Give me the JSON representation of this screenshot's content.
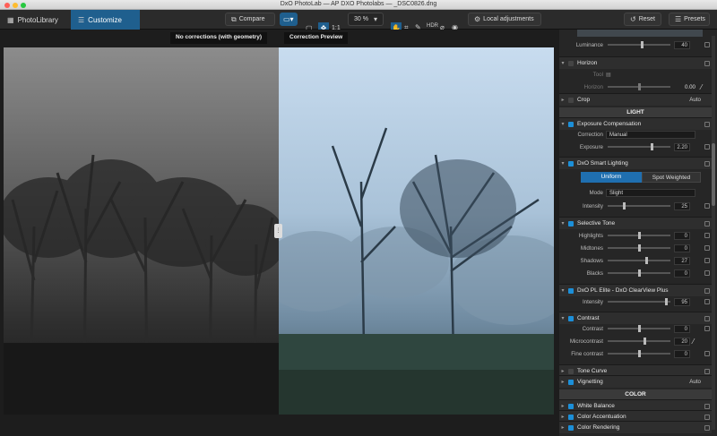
{
  "window": {
    "title": "DxO PhotoLab — AP DXO Photolabs — _DSC0826.dng"
  },
  "toolbar": {
    "tab_library": "PhotoLibrary",
    "tab_customize": "Customize",
    "compare_label": "Compare",
    "zoom_ratio": "1:1",
    "zoom_value": "30 %",
    "local_adjustments": "Local adjustments",
    "reset_label": "Reset",
    "presets_label": "Presets"
  },
  "viewer": {
    "left_title": "No corrections (with geometry)",
    "right_title": "Correction Preview"
  },
  "panel": {
    "luminance": {
      "label": "Luminance",
      "value": "40",
      "level": 0.55
    },
    "horizon": {
      "title": "Horizon",
      "tool_label": "Tool",
      "horizon_label": "Horizon",
      "value": "0.00"
    },
    "crop": {
      "title": "Crop",
      "value": "Auto"
    },
    "light_header": "LIGHT",
    "exposure": {
      "title": "Exposure Compensation",
      "correction_label": "Correction",
      "correction_value": "Manual",
      "exposure_label": "Exposure",
      "exposure_value": "2.20",
      "level": 0.72
    },
    "smart": {
      "title": "DxO Smart Lighting",
      "uniform": "Uniform",
      "spot": "Spot Weighted",
      "mode_label": "Mode",
      "mode_value": "Slight",
      "intensity_label": "Intensity",
      "intensity_value": "25",
      "level": 0.25
    },
    "selective": {
      "title": "Selective Tone",
      "rows": [
        {
          "label": "Highlights",
          "value": "0",
          "level": 0.5
        },
        {
          "label": "Midtones",
          "value": "0",
          "level": 0.5
        },
        {
          "label": "Shadows",
          "value": "27",
          "level": 0.63
        },
        {
          "label": "Blacks",
          "value": "0",
          "level": 0.5
        }
      ]
    },
    "clearview": {
      "title": "DxO PL Elite - DxO ClearView Plus",
      "intensity_label": "Intensity",
      "intensity_value": "95",
      "level": 0.95
    },
    "contrast": {
      "title": "Contrast",
      "rows": [
        {
          "label": "Contrast",
          "value": "0",
          "level": 0.5
        },
        {
          "label": "Microcontrast",
          "value": "20",
          "level": 0.6
        },
        {
          "label": "Fine contrast",
          "value": "0",
          "level": 0.5
        }
      ]
    },
    "tonecurve": {
      "title": "Tone Curve"
    },
    "vignetting": {
      "title": "Vignetting",
      "value": "Auto"
    },
    "color_header": "COLOR",
    "white_balance": {
      "title": "White Balance"
    },
    "color_accent": {
      "title": "Color Accentuation"
    },
    "color_render": {
      "title": "Color Rendering"
    }
  }
}
